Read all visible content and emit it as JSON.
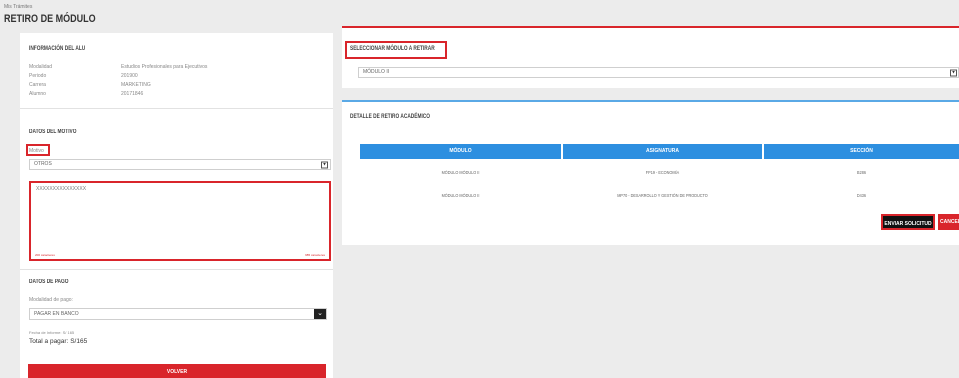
{
  "breadcrumb": "Mis Trámites",
  "page_title": "RETIRO DE MÓDULO",
  "info": {
    "title": "INFORMACIÓN DEL ALU",
    "rows": [
      {
        "label": "Modalidad",
        "value": "Estudios Profesionales para Ejecutivos"
      },
      {
        "label": "Periodo",
        "value": "201900"
      },
      {
        "label": "Carrera",
        "value": "MARKETING"
      },
      {
        "label": "Alumno",
        "value": "20171846"
      }
    ]
  },
  "motivo": {
    "title": "DATOS DEL MOTIVO",
    "label": "Motivo",
    "selected": "OTROS",
    "text": "XXXXXXXXXXXXXXX",
    "counter_left": "200 caracteres",
    "counter_right": "985 caracteres"
  },
  "pago": {
    "title": "DATOS DE PAGO",
    "label": "Modalidad de pago:",
    "selected": "PAGAR EN BANCO",
    "fecha_label": "Fecha de Informe: S/ 165",
    "total": "Total a pagar: S/165"
  },
  "volver_label": "VOLVER",
  "seleccionar": {
    "title": "SELECCIONAR MÓDULO A RETIRAR",
    "selected": "MÓDULO II"
  },
  "detalle": {
    "title": "DETALLE DE RETIRO ACADÉMICO",
    "headers": [
      "MÓDULO",
      "ASIGNATURA",
      "SECCIÓN"
    ],
    "rows": [
      [
        "MÓDULO MÓDULO II",
        "FP19 - ECONOMÍA",
        "B286"
      ],
      [
        "MÓDULO MÓDULO II",
        "MP70 - DESARROLLO Y GESTIÓN DE PRODUCTO",
        "D436"
      ]
    ]
  },
  "enviar_label": "ENVIAR SOLICITUD",
  "cancelar_label": "CANCELAR"
}
